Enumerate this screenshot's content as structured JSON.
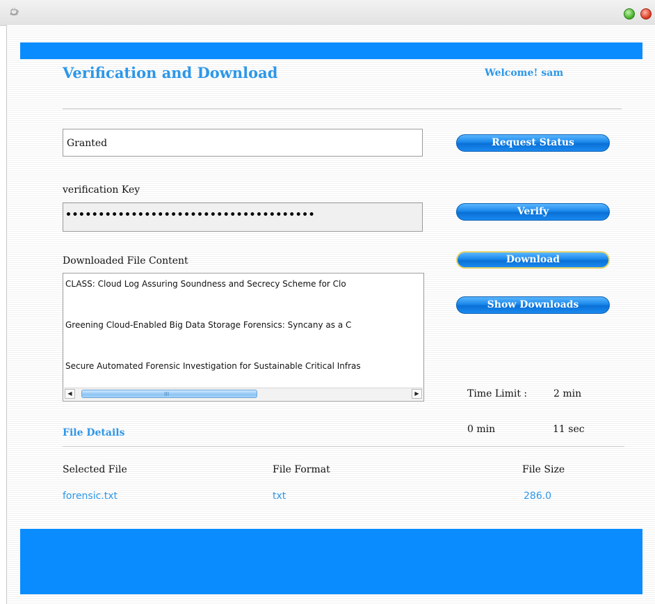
{
  "window": {
    "app_icon": "coffee-cup-icon",
    "controls": [
      "maximize-icon",
      "close-icon"
    ]
  },
  "header": {
    "title": "Verification and Download",
    "welcome": "Welcome! sam"
  },
  "request": {
    "status_value": "Granted",
    "request_status_label": "Request Status"
  },
  "verification": {
    "key_label": "verification Key",
    "masked_value": "••••••••••••••••••••••••••••••••••••••",
    "verify_label": "Verify"
  },
  "downloads": {
    "content_label": "Downloaded File Content",
    "download_label": "Download",
    "show_downloads_label": "Show Downloads",
    "items": [
      "CLASS: Cloud Log Assuring Soundness and Secrecy Scheme for Clo",
      "Greening Cloud-Enabled Big Data Storage Forensics: Syncany as a C",
      "Secure Automated Forensic Investigation for Sustainable Critical Infras"
    ],
    "scroll_grip": "III"
  },
  "timer": {
    "limit_label": "Time Limit :",
    "limit_value": "2 min",
    "elapsed_min": "0 min",
    "elapsed_sec": "11 sec"
  },
  "file_details": {
    "title": "File Details",
    "headers": [
      "Selected File",
      "File Format",
      "File Size"
    ],
    "values": [
      "forensic.txt",
      "txt",
      "286.0"
    ]
  },
  "colors": {
    "accent": "#0a8cff",
    "title_text": "#2d97e8"
  }
}
